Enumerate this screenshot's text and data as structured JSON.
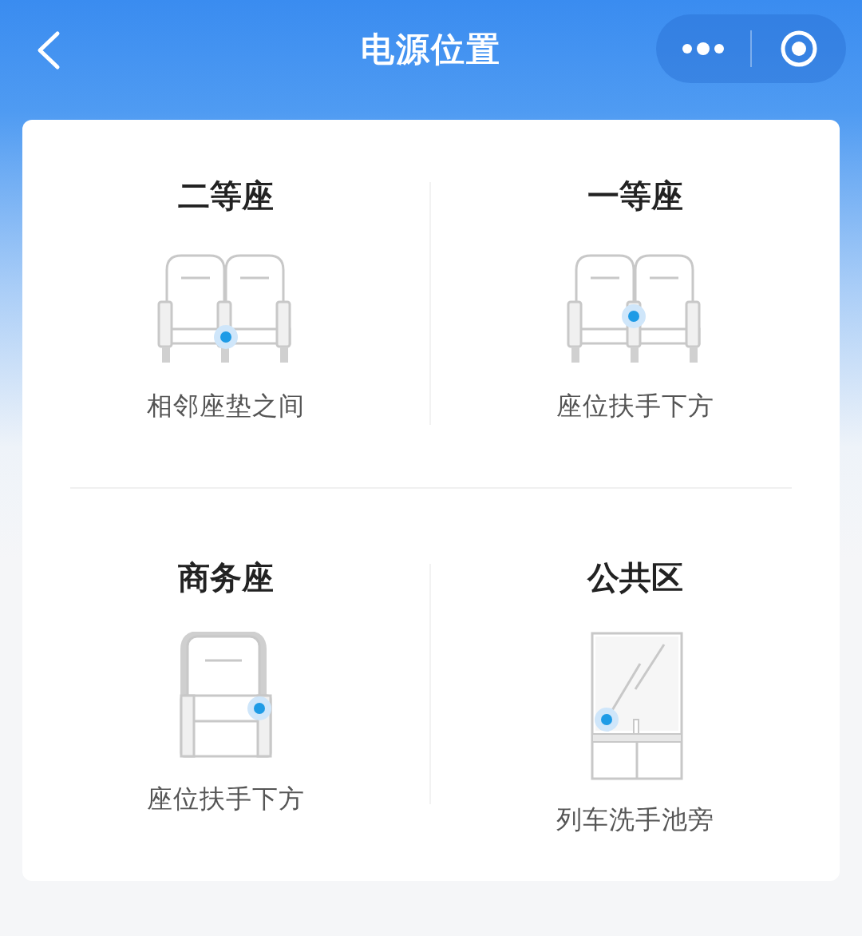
{
  "header": {
    "title": "电源位置"
  },
  "cells": [
    {
      "kind": "twin-cushion",
      "title": "二等座",
      "label": "相邻座垫之间"
    },
    {
      "kind": "twin-armrest",
      "title": "一等座",
      "label": "座位扶手下方"
    },
    {
      "kind": "single",
      "title": "商务座",
      "label": "座位扶手下方"
    },
    {
      "kind": "basin",
      "title": "公共区",
      "label": "列车洗手池旁"
    }
  ]
}
